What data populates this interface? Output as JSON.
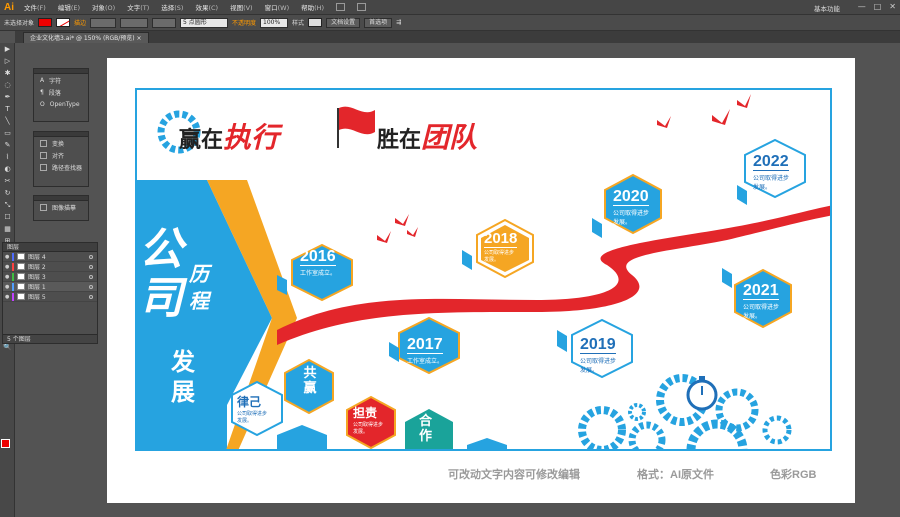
{
  "menubar": {
    "app": "Ai",
    "items": [
      {
        "label": "文件",
        "key": "(F)"
      },
      {
        "label": "编辑",
        "key": "(E)"
      },
      {
        "label": "对象",
        "key": "(O)"
      },
      {
        "label": "文字",
        "key": "(T)"
      },
      {
        "label": "选择",
        "key": "(S)"
      },
      {
        "label": "效果",
        "key": "(C)"
      },
      {
        "label": "视图",
        "key": "(V)"
      },
      {
        "label": "窗口",
        "key": "(W)"
      },
      {
        "label": "帮助",
        "key": "(H)"
      }
    ],
    "workspace": "基本功能",
    "win_min": "—",
    "win_max": "□",
    "win_close": "✕"
  },
  "control": {
    "selection": "未选择对象",
    "stroke_label": "描边",
    "brush": "5 点圆形",
    "opacity_label": "不透明度",
    "opacity_value": "100%",
    "style_label": "样式",
    "doc_setup": "文档设置",
    "prefs": "首选项"
  },
  "tab": {
    "title": "企业文化墙3.ai* @ 150% (RGB/预览)",
    "close": "×"
  },
  "tools": [
    "▶",
    "▷",
    "✱",
    "◌",
    "✒",
    "T",
    "╲",
    "▭",
    "✎",
    "⌇",
    "◐",
    "✂",
    "↻",
    "⤡",
    "☐",
    "▦",
    "⊞",
    "⌖",
    "✋",
    "🔍"
  ],
  "panels": {
    "char": [
      "字符",
      "段落",
      "OpenType"
    ],
    "transform": [
      "变换",
      "对齐",
      "路径查找器"
    ],
    "image_trace": "图像描摹",
    "layers_title": "图层",
    "layers": [
      {
        "name": "图层 4",
        "color": "#4f6bff"
      },
      {
        "name": "图层 2",
        "color": "#ff4040"
      },
      {
        "name": "图层 3",
        "color": "#3fbf3f"
      },
      {
        "name": "图层 1",
        "color": "#4f9fff"
      },
      {
        "name": "图层 5",
        "color": "#c040ff"
      }
    ],
    "layers_count": "5 个图层"
  },
  "art": {
    "slogan1": "赢在",
    "slogan1b": "执行",
    "slogan2": "胜在",
    "slogan2b": "团队",
    "title_big": [
      "公",
      "司"
    ],
    "title_small": [
      "历",
      "程"
    ],
    "title_dev": [
      "发",
      "展"
    ],
    "years": [
      {
        "year": "2016",
        "line1": "工作室成立。"
      },
      {
        "year": "2017",
        "line1": "工作室成立。"
      },
      {
        "year": "2018",
        "line1": "公司取得进步",
        "line2": "发展。"
      },
      {
        "year": "2019",
        "line1": "公司取得进步",
        "line2": "发展。"
      },
      {
        "year": "2020",
        "line1": "公司取得进步",
        "line2": "发展。"
      },
      {
        "year": "2021",
        "line1": "公司取得进步",
        "line2": "发展。"
      },
      {
        "year": "2022",
        "line1": "公司取得进步",
        "line2": "发展。"
      }
    ],
    "values": [
      {
        "word": "律己",
        "line1": "公司取得进步",
        "line2": "发展。"
      },
      {
        "word": "共赢"
      },
      {
        "word": "担责",
        "line1": "公司取得进步",
        "line2": "发展。"
      },
      {
        "word": "合作"
      }
    ]
  },
  "credits": [
    "可改动文字内容可修改编辑",
    "格式：AI原文件",
    "色彩RGB"
  ]
}
